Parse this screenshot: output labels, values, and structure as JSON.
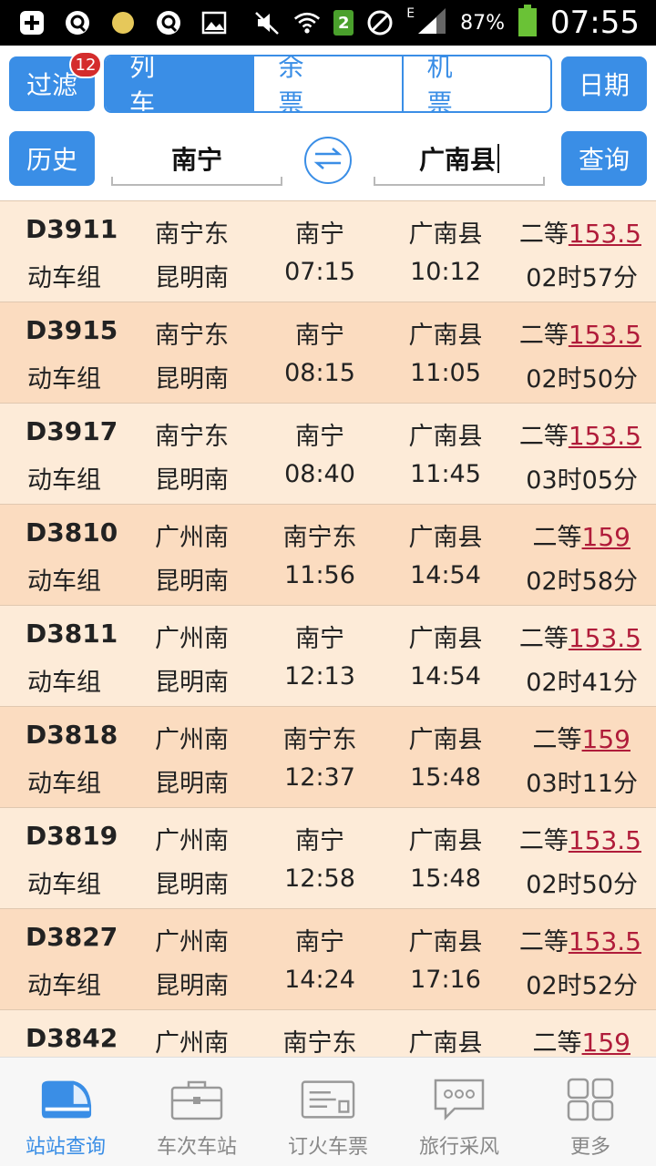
{
  "status_bar": {
    "battery_pct": "87%",
    "time": "07:55",
    "sim_badge": "2",
    "network_label": "E"
  },
  "header": {
    "filter_label": "过滤",
    "filter_badge": "12",
    "tabs": [
      "列 车",
      "余 票",
      "机 票"
    ],
    "active_tab": 0,
    "date_label": "日期",
    "history_label": "历史",
    "from_station": "南宁",
    "to_station": "广南县",
    "query_label": "查询"
  },
  "colors": {
    "accent": "#3a8ee6",
    "row_light": "#fdebd8",
    "row_dark": "#fbdcc0",
    "price": "#b01c3a"
  },
  "trains": [
    {
      "no": "D3911",
      "type": "动车组",
      "origin": "南宁东",
      "terminal": "昆明南",
      "depart_station": "南宁",
      "depart_time": "07:15",
      "arrive_station": "广南县",
      "arrive_time": "10:12",
      "seat": "二等",
      "price": "153.5",
      "duration": "02时57分"
    },
    {
      "no": "D3915",
      "type": "动车组",
      "origin": "南宁东",
      "terminal": "昆明南",
      "depart_station": "南宁",
      "depart_time": "08:15",
      "arrive_station": "广南县",
      "arrive_time": "11:05",
      "seat": "二等",
      "price": "153.5",
      "duration": "02时50分"
    },
    {
      "no": "D3917",
      "type": "动车组",
      "origin": "南宁东",
      "terminal": "昆明南",
      "depart_station": "南宁",
      "depart_time": "08:40",
      "arrive_station": "广南县",
      "arrive_time": "11:45",
      "seat": "二等",
      "price": "153.5",
      "duration": "03时05分"
    },
    {
      "no": "D3810",
      "type": "动车组",
      "origin": "广州南",
      "terminal": "昆明南",
      "depart_station": "南宁东",
      "depart_time": "11:56",
      "arrive_station": "广南县",
      "arrive_time": "14:54",
      "seat": "二等",
      "price": "159",
      "duration": "02时58分"
    },
    {
      "no": "D3811",
      "type": "动车组",
      "origin": "广州南",
      "terminal": "昆明南",
      "depart_station": "南宁",
      "depart_time": "12:13",
      "arrive_station": "广南县",
      "arrive_time": "14:54",
      "seat": "二等",
      "price": "153.5",
      "duration": "02时41分"
    },
    {
      "no": "D3818",
      "type": "动车组",
      "origin": "广州南",
      "terminal": "昆明南",
      "depart_station": "南宁东",
      "depart_time": "12:37",
      "arrive_station": "广南县",
      "arrive_time": "15:48",
      "seat": "二等",
      "price": "159",
      "duration": "03时11分"
    },
    {
      "no": "D3819",
      "type": "动车组",
      "origin": "广州南",
      "terminal": "昆明南",
      "depart_station": "南宁",
      "depart_time": "12:58",
      "arrive_station": "广南县",
      "arrive_time": "15:48",
      "seat": "二等",
      "price": "153.5",
      "duration": "02时50分"
    },
    {
      "no": "D3827",
      "type": "动车组",
      "origin": "广州南",
      "terminal": "昆明南",
      "depart_station": "南宁",
      "depart_time": "14:24",
      "arrive_station": "广南县",
      "arrive_time": "17:16",
      "seat": "二等",
      "price": "153.5",
      "duration": "02时52分"
    },
    {
      "no": "D3842",
      "type": "",
      "origin": "广州南",
      "terminal": "",
      "depart_station": "南宁东",
      "depart_time": "",
      "arrive_station": "广南县",
      "arrive_time": "",
      "seat": "二等",
      "price": "159",
      "duration": ""
    }
  ],
  "bottom_nav": [
    {
      "label": "站站查询",
      "icon": "train-icon",
      "active": true
    },
    {
      "label": "车次车站",
      "icon": "briefcase-icon",
      "active": false
    },
    {
      "label": "订火车票",
      "icon": "ticket-icon",
      "active": false
    },
    {
      "label": "旅行采风",
      "icon": "chat-icon",
      "active": false
    },
    {
      "label": "更多",
      "icon": "grid-icon",
      "active": false
    }
  ]
}
